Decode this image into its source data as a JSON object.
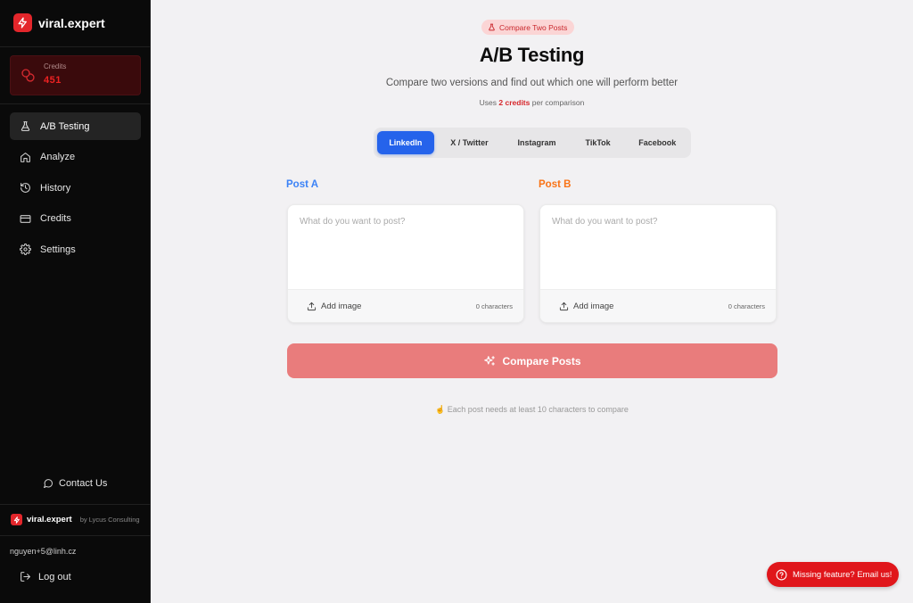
{
  "sidebar": {
    "brand_name": "viral.expert",
    "credits": {
      "label": "Credits",
      "value": "451"
    },
    "nav": [
      {
        "label": "A/B Testing",
        "icon": "flask-icon",
        "active": true
      },
      {
        "label": "Analyze",
        "icon": "home-icon"
      },
      {
        "label": "History",
        "icon": "history-icon"
      },
      {
        "label": "Credits",
        "icon": "credit-card-icon"
      },
      {
        "label": "Settings",
        "icon": "gear-icon"
      }
    ],
    "contact_label": "Contact Us",
    "footer": {
      "brand": "viral.expert",
      "by": "by Lycus Consulting"
    },
    "user_email": "nguyen+5@linh.cz",
    "logout_label": "Log out"
  },
  "header": {
    "pill_label": "Compare Two Posts",
    "title": "A/B Testing",
    "subtitle": "Compare two versions and find out which one will perform better",
    "uses_prefix": "Uses ",
    "uses_credits": "2 credits",
    "uses_suffix": " per comparison"
  },
  "platform_tabs": [
    {
      "label": "LinkedIn",
      "active": true
    },
    {
      "label": "X / Twitter"
    },
    {
      "label": "Instagram"
    },
    {
      "label": "TikTok"
    },
    {
      "label": "Facebook"
    }
  ],
  "post_a": {
    "label": "Post A",
    "placeholder": "What do you want to post?",
    "value": "",
    "add_image": "Add image",
    "char_count": "0 characters"
  },
  "post_b": {
    "label": "Post B",
    "placeholder": "What do you want to post?",
    "value": "",
    "add_image": "Add image",
    "char_count": "0 characters"
  },
  "compare_button": "Compare Posts",
  "hint": "Each post needs at least 10 characters to compare",
  "missing_feature": "Missing feature? Email us!",
  "colors": {
    "brand_red": "#e3262b",
    "active_tab": "#2563eb",
    "post_a": "#3b82f6",
    "post_b": "#f97316",
    "compare_disabled": "#e97c7c"
  }
}
